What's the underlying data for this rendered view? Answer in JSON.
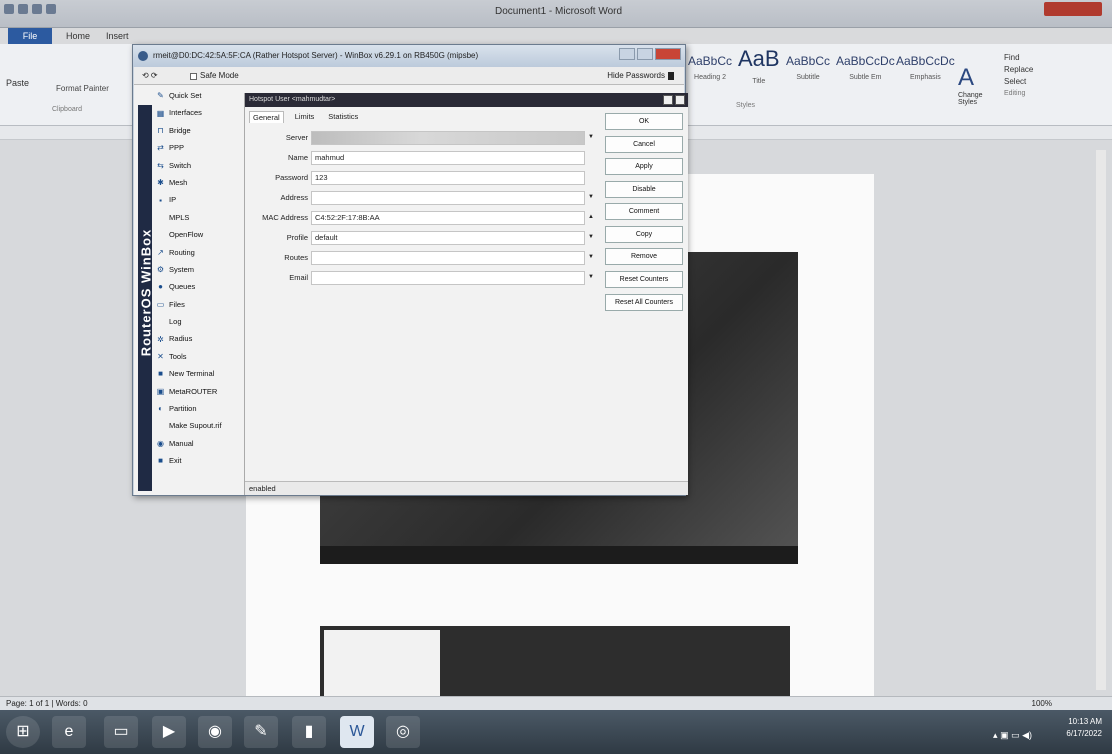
{
  "word": {
    "title": "Document1 - Microsoft Word",
    "tabs": {
      "file": "File",
      "home": "Home",
      "insert": "Insert"
    },
    "clipboard": {
      "paste": "Paste",
      "format_painter": "Format Painter",
      "group": "Clipboard"
    },
    "styles": [
      {
        "preview": "AaBbCc",
        "name": "Heading 2"
      },
      {
        "preview": "AaB",
        "name": "Title"
      },
      {
        "preview": "AaBbCc",
        "name": "Subtitle"
      },
      {
        "preview": "AaBbCcDc",
        "name": "Subtle Em"
      },
      {
        "preview": "AaBbCcDc",
        "name": "Emphasis"
      }
    ],
    "styles_group": "Styles",
    "change_styles": "Change Styles",
    "editing": {
      "find": "Find",
      "replace": "Replace",
      "select": "Select",
      "group": "Editing"
    },
    "status": {
      "page": "Page: 1 of 1",
      "words": "Words: 0",
      "zoom": "100%"
    }
  },
  "winbox": {
    "title": "rmeit@D0:DC:42:5A:5F:CA (Rather Hotspot Server) - WinBox v6.29.1 on RB450G (mipsbe)",
    "undo": "⟲ ⟳",
    "safe_mode": "Safe Mode",
    "hide_passwords": "Hide Passwords",
    "side_label": "RouterOS WinBox",
    "menu": [
      {
        "icon": "quick-set-icon",
        "glyph": "✎",
        "label": "Quick Set"
      },
      {
        "icon": "interfaces-icon",
        "glyph": "▦",
        "label": "Interfaces"
      },
      {
        "icon": "bridge-icon",
        "glyph": "⊓",
        "label": "Bridge"
      },
      {
        "icon": "ppp-icon",
        "glyph": "⇄",
        "label": "PPP"
      },
      {
        "icon": "switch-icon",
        "glyph": "⇆",
        "label": "Switch"
      },
      {
        "icon": "mesh-icon",
        "glyph": "✱",
        "label": "Mesh"
      },
      {
        "icon": "ip-icon",
        "glyph": "▪",
        "label": "IP"
      },
      {
        "icon": "mpls-icon",
        "glyph": "",
        "label": "MPLS"
      },
      {
        "icon": "openflow-icon",
        "glyph": "",
        "label": "OpenFlow"
      },
      {
        "icon": "routing-icon",
        "glyph": "↗",
        "label": "Routing"
      },
      {
        "icon": "system-icon",
        "glyph": "⚙",
        "label": "System"
      },
      {
        "icon": "queues-icon",
        "glyph": "●",
        "label": "Queues"
      },
      {
        "icon": "files-icon",
        "glyph": "▭",
        "label": "Files"
      },
      {
        "icon": "log-icon",
        "glyph": "",
        "label": "Log"
      },
      {
        "icon": "radius-icon",
        "glyph": "✲",
        "label": "Radius"
      },
      {
        "icon": "tools-icon",
        "glyph": "✕",
        "label": "Tools"
      },
      {
        "icon": "new-terminal-icon",
        "glyph": "■",
        "label": "New Terminal"
      },
      {
        "icon": "metarouter-icon",
        "glyph": "▣",
        "label": "MetaROUTER"
      },
      {
        "icon": "partition-icon",
        "glyph": "◐",
        "label": "Partition"
      },
      {
        "icon": "make-supout-icon",
        "glyph": "",
        "label": "Make Supout.rif"
      },
      {
        "icon": "manual-icon",
        "glyph": "◉",
        "label": "Manual"
      },
      {
        "icon": "exit-icon",
        "glyph": "■",
        "label": "Exit"
      }
    ],
    "dialog": {
      "title": "Hotspot User <mahmudtar>",
      "tabs": [
        "General",
        "Limits",
        "Statistics"
      ],
      "fields": [
        {
          "label": "Server",
          "value": "",
          "shaded": true,
          "arrow": "▼"
        },
        {
          "label": "Name",
          "value": "mahmud",
          "shaded": false,
          "arrow": ""
        },
        {
          "label": "Password",
          "value": "123",
          "shaded": false,
          "arrow": ""
        },
        {
          "label": "Address",
          "value": "",
          "shaded": false,
          "arrow": "▼"
        },
        {
          "label": "MAC Address",
          "value": "C4:52:2F:17:8B:AA",
          "shaded": false,
          "arrow": "▲"
        },
        {
          "label": "Profile",
          "value": "default",
          "shaded": false,
          "arrow": "▼"
        },
        {
          "label": "Routes",
          "value": "",
          "shaded": false,
          "arrow": "▼"
        },
        {
          "label": "Email",
          "value": "",
          "shaded": false,
          "arrow": "▼"
        }
      ],
      "buttons": [
        "OK",
        "Cancel",
        "Apply",
        "Disable",
        "Comment",
        "Copy",
        "Remove",
        "Reset Counters",
        "Reset All Counters"
      ],
      "status": "enabled"
    }
  },
  "taskbar": {
    "time": "10:13 AM",
    "date": "6/17/2022",
    "tray": "▴ ▣ ▭ ◀)"
  }
}
